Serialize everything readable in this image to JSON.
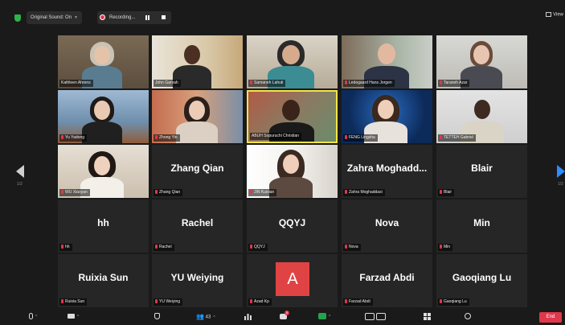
{
  "topbar": {
    "original_sound": "Original Sound: On",
    "recording": "Recording...",
    "view": "View"
  },
  "pager": {
    "left": "1/2",
    "right": "1/2"
  },
  "participants": [
    {
      "label": "Kathleen Ahrens",
      "video": true
    },
    {
      "label": "John Garvah",
      "video": true
    },
    {
      "label": "Samaneh Lahuti",
      "video": true
    },
    {
      "label": "Ledegaard Hans Jorgen",
      "video": true
    },
    {
      "label": "Taraneh Azar",
      "video": true
    },
    {
      "label": "Yu Yadong",
      "video": true
    },
    {
      "label": "Zhong Yin",
      "video": true
    },
    {
      "label": "ABUH Sopuruchi Christian",
      "video": true,
      "active": true
    },
    {
      "label": "FENG Lingsha",
      "video": true
    },
    {
      "label": "TETTEH Gabriel",
      "video": true
    },
    {
      "label": "WU Xiaoyan",
      "video": true
    },
    {
      "label": "Zhang Qian",
      "display": "Zhang Qian"
    },
    {
      "label": "JIN Kuixian",
      "video": true
    },
    {
      "label": "Zahra Moghaddasi",
      "display": "Zahra Moghadd..."
    },
    {
      "label": "Blair",
      "display": "Blair"
    },
    {
      "label": "hh",
      "display": "hh"
    },
    {
      "label": "Rachel",
      "display": "Rachel"
    },
    {
      "label": "QQYJ",
      "display": "QQYJ"
    },
    {
      "label": "Nova",
      "display": "Nova"
    },
    {
      "label": "Min",
      "display": "Min"
    },
    {
      "label": "Ruixia Sun",
      "display": "Ruixia Sun"
    },
    {
      "label": "YU Weiying",
      "display": "YU Weiying"
    },
    {
      "label": "Azad Kp",
      "avatar": "A"
    },
    {
      "label": "Farzad Abdi",
      "display": "Farzad Abdi"
    },
    {
      "label": "Gaoqiang Lu",
      "display": "Gaoqiang Lu"
    }
  ],
  "toolbar": {
    "participants_count": "43",
    "chat_badge": "5",
    "end": "End"
  },
  "colors": {
    "accent": "#2d8cff",
    "end": "#e0384b",
    "active_border": "#f2e547"
  }
}
